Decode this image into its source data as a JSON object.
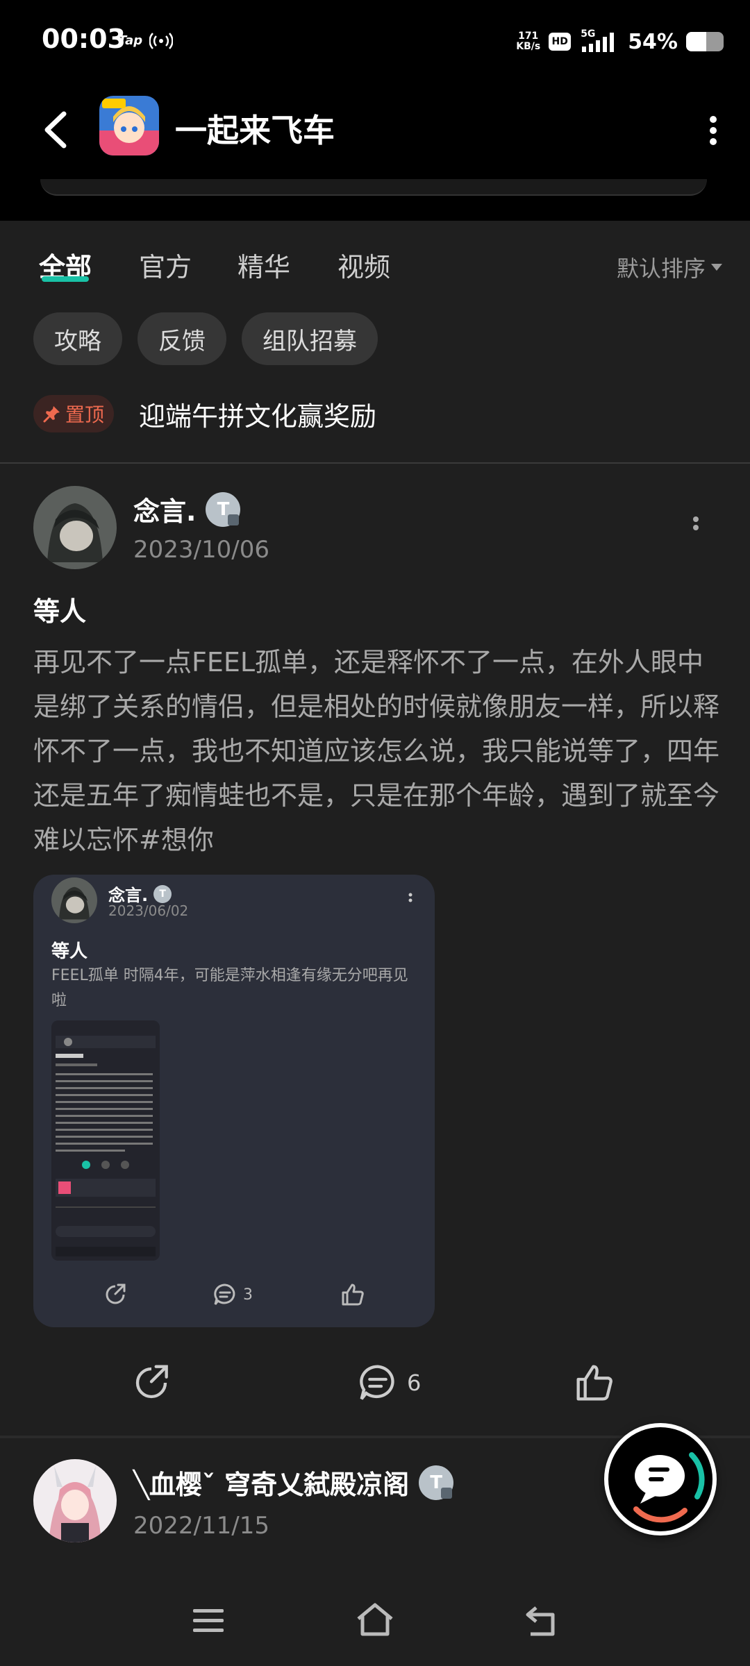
{
  "status_bar": {
    "time": "00:03",
    "tap_label": "Tap",
    "net_speed_value": "171",
    "net_speed_unit": "KB/s",
    "hd_label": "HD",
    "network_type": "5G",
    "battery_percent": "54%",
    "battery_level": 0.54
  },
  "header": {
    "title": "一起来飞车",
    "back_icon": "back-arrow-icon",
    "more_icon": "vertical-dots-icon"
  },
  "tabs": {
    "items": [
      {
        "label": "全部",
        "active": true
      },
      {
        "label": "官方",
        "active": false
      },
      {
        "label": "精华",
        "active": false
      },
      {
        "label": "视频",
        "active": false
      }
    ],
    "sort_label": "默认排序",
    "accent_color": "#19c1a6"
  },
  "chips": [
    "攻略",
    "反馈",
    "组队招募"
  ],
  "pinned": {
    "badge_label": "置顶",
    "title": "迎端午拼文化赢奖励",
    "badge_color": "#ef6a4f"
  },
  "post": {
    "username": "念言.",
    "badge": "T",
    "date": "2023/10/06",
    "title": "等人",
    "body": "再见不了一点FEEL孤单，还是释怀不了一点，在外人眼中是绑了关系的情侣，但是相处的时候就像朋友一样，所以释怀不了一点，我也不知道应该怎么说，我只能说等了，四年还是五年了痴情蛙也不是，只是在那个年龄，遇到了就至今难以忘怀#想你",
    "quoted": {
      "username": "念言.",
      "badge": "T",
      "date": "2023/06/02",
      "title": "等人",
      "body": "FEEL孤单 时隔4年，可能是萍水相逢有缘无分吧再见啦",
      "comment_count": "3"
    },
    "comment_count": "6"
  },
  "next_post": {
    "username": "╲血樱ˇ 穹奇乂弑殿凉阁",
    "badge": "T",
    "date": "2022/11/15"
  },
  "nav": {
    "menu_icon": "menu-icon",
    "home_icon": "home-icon",
    "back_icon": "back-icon"
  }
}
